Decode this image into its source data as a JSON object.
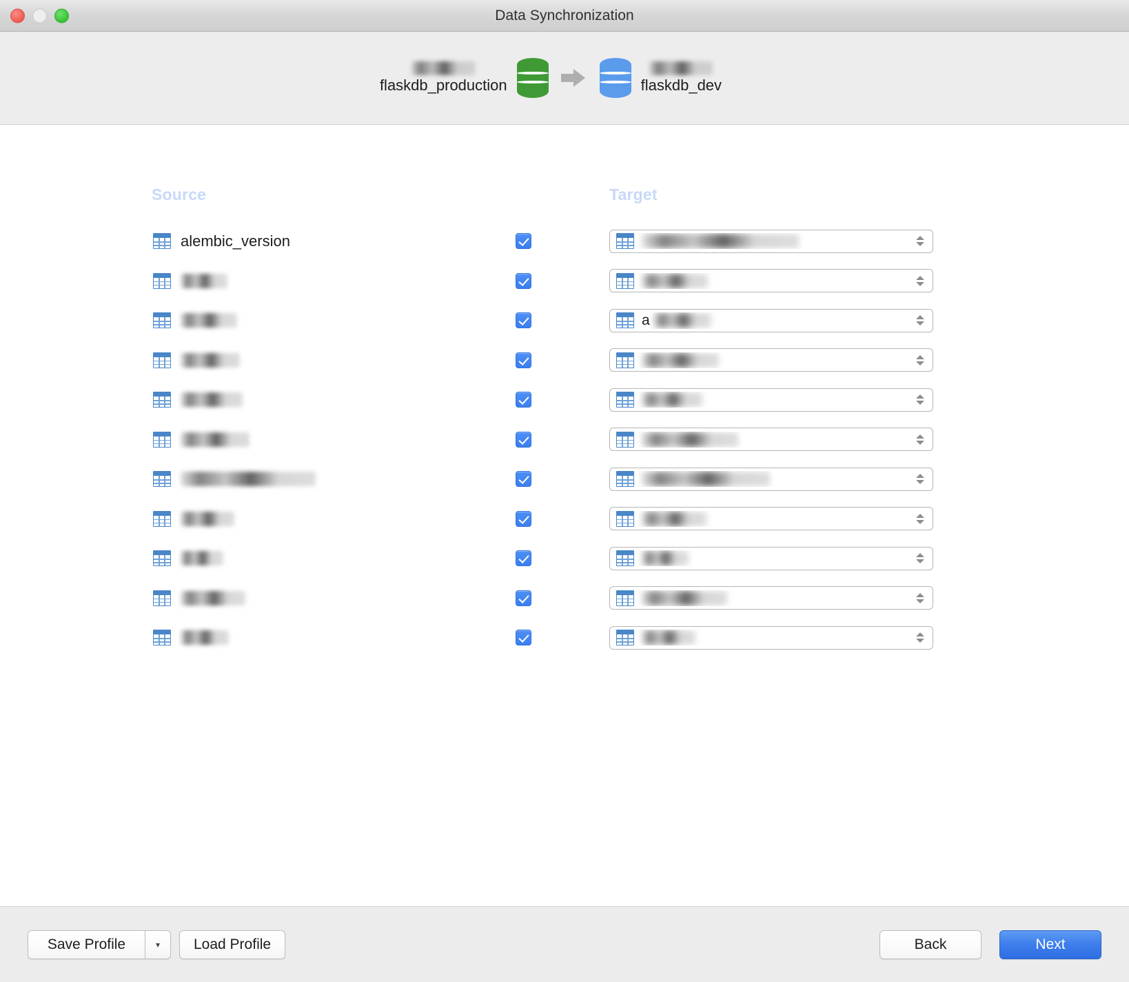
{
  "window": {
    "title": "Data Synchronization",
    "traffic_lights": [
      "close-button",
      "minimize-button",
      "maximize-button"
    ]
  },
  "header": {
    "source": {
      "label": "flaskdb_production",
      "redacted_label": "",
      "icon": "database-cylinder-green",
      "color": "#3f9a35"
    },
    "direction_icon": "arrow-right-icon",
    "target": {
      "label": "flaskdb_dev",
      "redacted_label": "",
      "icon": "database-cylinder-blue",
      "color": "#5b9bec"
    }
  },
  "columns": {
    "source_heading": "Source",
    "target_heading": "Target",
    "heading_color": "#c6d9f7"
  },
  "mappings": [
    {
      "source_label": "alembic_version",
      "source_redacted": false,
      "source_blur_width": 0,
      "checked": true,
      "target_label": "",
      "target_redacted": true,
      "target_blur_width": 228
    },
    {
      "source_label": "",
      "source_redacted": true,
      "source_blur_width": 68,
      "checked": true,
      "target_label": "",
      "target_redacted": true,
      "target_blur_width": 96
    },
    {
      "source_label": "",
      "source_redacted": true,
      "source_blur_width": 82,
      "checked": true,
      "target_label": "a",
      "target_redacted": true,
      "target_blur_width": 84
    },
    {
      "source_label": "",
      "source_redacted": true,
      "source_blur_width": 86,
      "checked": true,
      "target_label": "",
      "target_redacted": true,
      "target_blur_width": 112
    },
    {
      "source_label": "",
      "source_redacted": true,
      "source_blur_width": 90,
      "checked": true,
      "target_label": "",
      "target_redacted": true,
      "target_blur_width": 88
    },
    {
      "source_label": "",
      "source_redacted": true,
      "source_blur_width": 100,
      "checked": true,
      "target_label": "",
      "target_redacted": true,
      "target_blur_width": 140
    },
    {
      "source_label": "",
      "source_redacted": true,
      "source_blur_width": 196,
      "checked": true,
      "target_label": "",
      "target_redacted": true,
      "target_blur_width": 186
    },
    {
      "source_label": "",
      "source_redacted": true,
      "source_blur_width": 78,
      "checked": true,
      "target_label": "",
      "target_redacted": true,
      "target_blur_width": 94
    },
    {
      "source_label": "",
      "source_redacted": true,
      "source_blur_width": 62,
      "checked": true,
      "target_label": "",
      "target_redacted": true,
      "target_blur_width": 68
    },
    {
      "source_label": "",
      "source_redacted": true,
      "source_blur_width": 94,
      "checked": true,
      "target_label": "",
      "target_redacted": true,
      "target_blur_width": 124
    },
    {
      "source_label": "",
      "source_redacted": true,
      "source_blur_width": 70,
      "checked": true,
      "target_label": "",
      "target_redacted": true,
      "target_blur_width": 78
    }
  ],
  "footer": {
    "save_profile_label": "Save Profile",
    "save_profile_menu_glyph": "▾",
    "load_profile_label": "Load Profile",
    "back_label": "Back",
    "next_label": "Next",
    "next_color": "#3c7ceb"
  }
}
